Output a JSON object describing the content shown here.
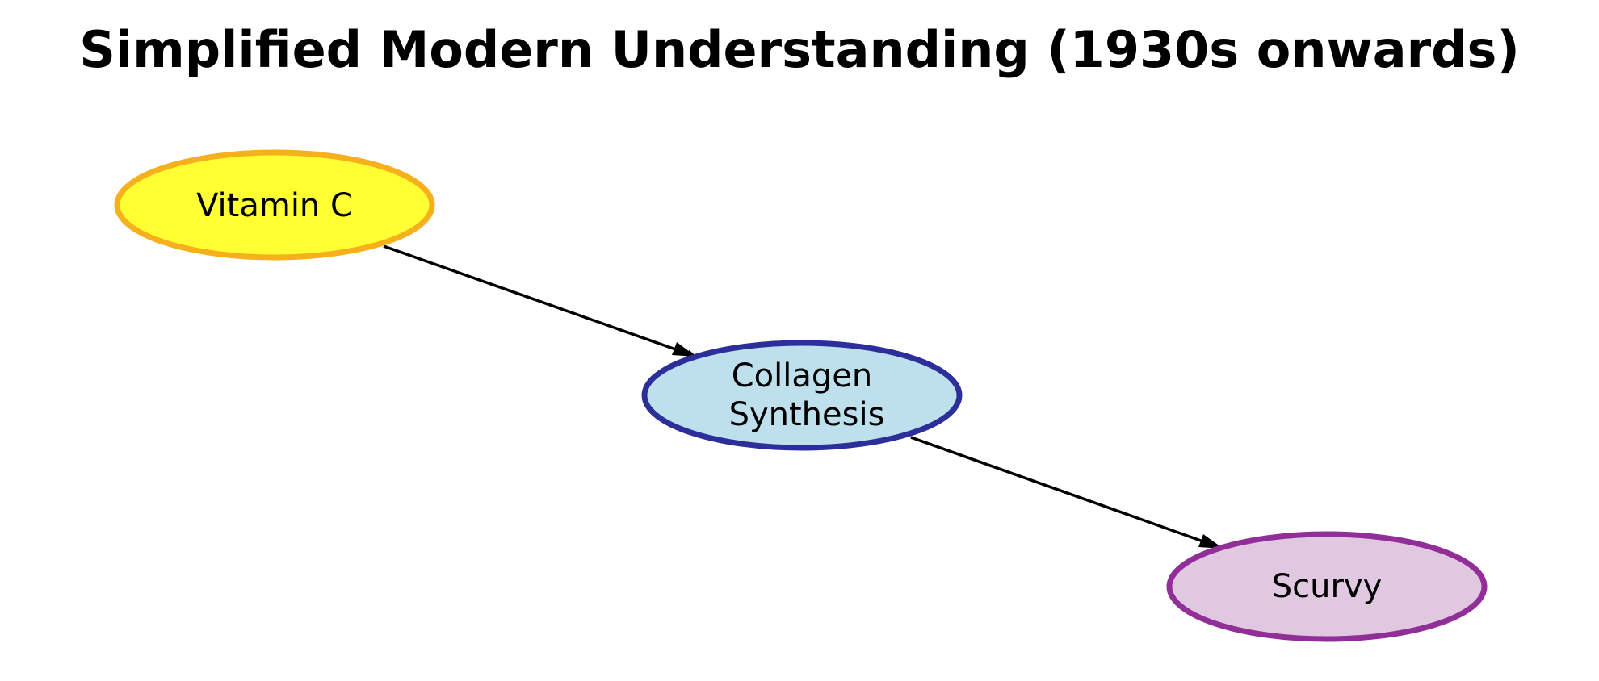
{
  "title": "Simplified Modern Understanding (1930s onwards)",
  "nodes": {
    "vitamin_c": {
      "label_lines": [
        "Vitamin C"
      ],
      "fill": "#ffff33",
      "stroke": "#f5b01c"
    },
    "collagen": {
      "label_lines": [
        "Collagen",
        "Synthesis"
      ],
      "fill": "#bde0ec",
      "stroke": "#2c2f9a"
    },
    "scurvy": {
      "label_lines": [
        "Scurvy"
      ],
      "fill": "#dfc8e0",
      "stroke": "#922e98"
    }
  },
  "edges": [
    {
      "from": "vitamin_c",
      "to": "collagen"
    },
    {
      "from": "collagen",
      "to": "scurvy"
    }
  ],
  "edge_color": "#000000"
}
